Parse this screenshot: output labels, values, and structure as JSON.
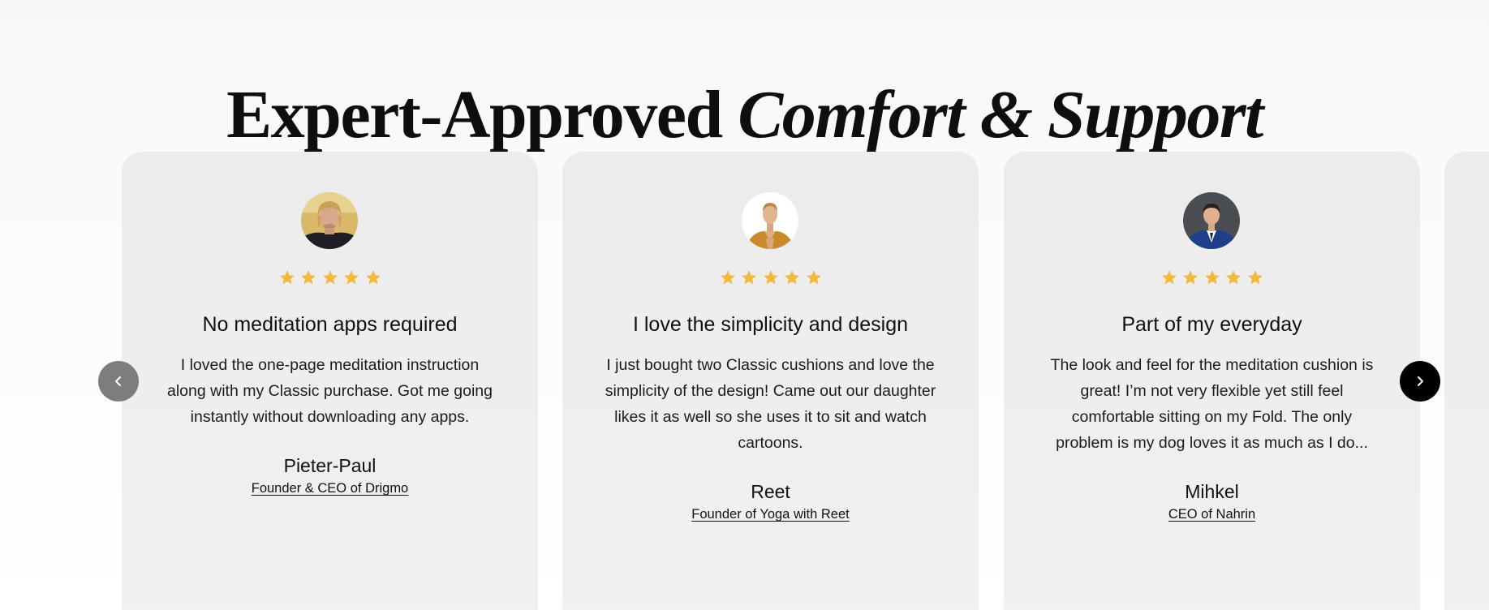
{
  "section": {
    "title_regular": "Expert-Approved",
    "title_italic": "Comfort & Support"
  },
  "icons": {
    "star": "star-icon",
    "prev": "chevron-left-icon",
    "next": "chevron-right-icon"
  },
  "colors": {
    "star": "#F2B93B",
    "card_background": "#EEEEEE",
    "next_button": "#000000",
    "prev_button": "#7D7D7D"
  },
  "testimonials": [
    {
      "rating": 5,
      "title": "No meditation apps required",
      "text": "I loved the one-page meditation instruction along with my Classic purchase. Got me going instantly without downloading any apps.",
      "name": "Pieter-Paul",
      "role": "Founder & CEO of Drigmo"
    },
    {
      "rating": 5,
      "title": "I love the simplicity and design",
      "text": "I just bought two Classic cushions and love the simplicity of the design! Came out our daughter likes it as well so she uses it to sit and watch cartoons.",
      "name": "Reet",
      "role": "Founder of Yoga with Reet"
    },
    {
      "rating": 5,
      "title": "Part of my everyday",
      "text": "The look and feel for the meditation cushion is great! I’m not very flexible yet still feel comfortable sitting on my Fold. The only problem is my dog loves it as much as I do...",
      "name": "Mihkel",
      "role": "CEO of Nahrin"
    }
  ]
}
